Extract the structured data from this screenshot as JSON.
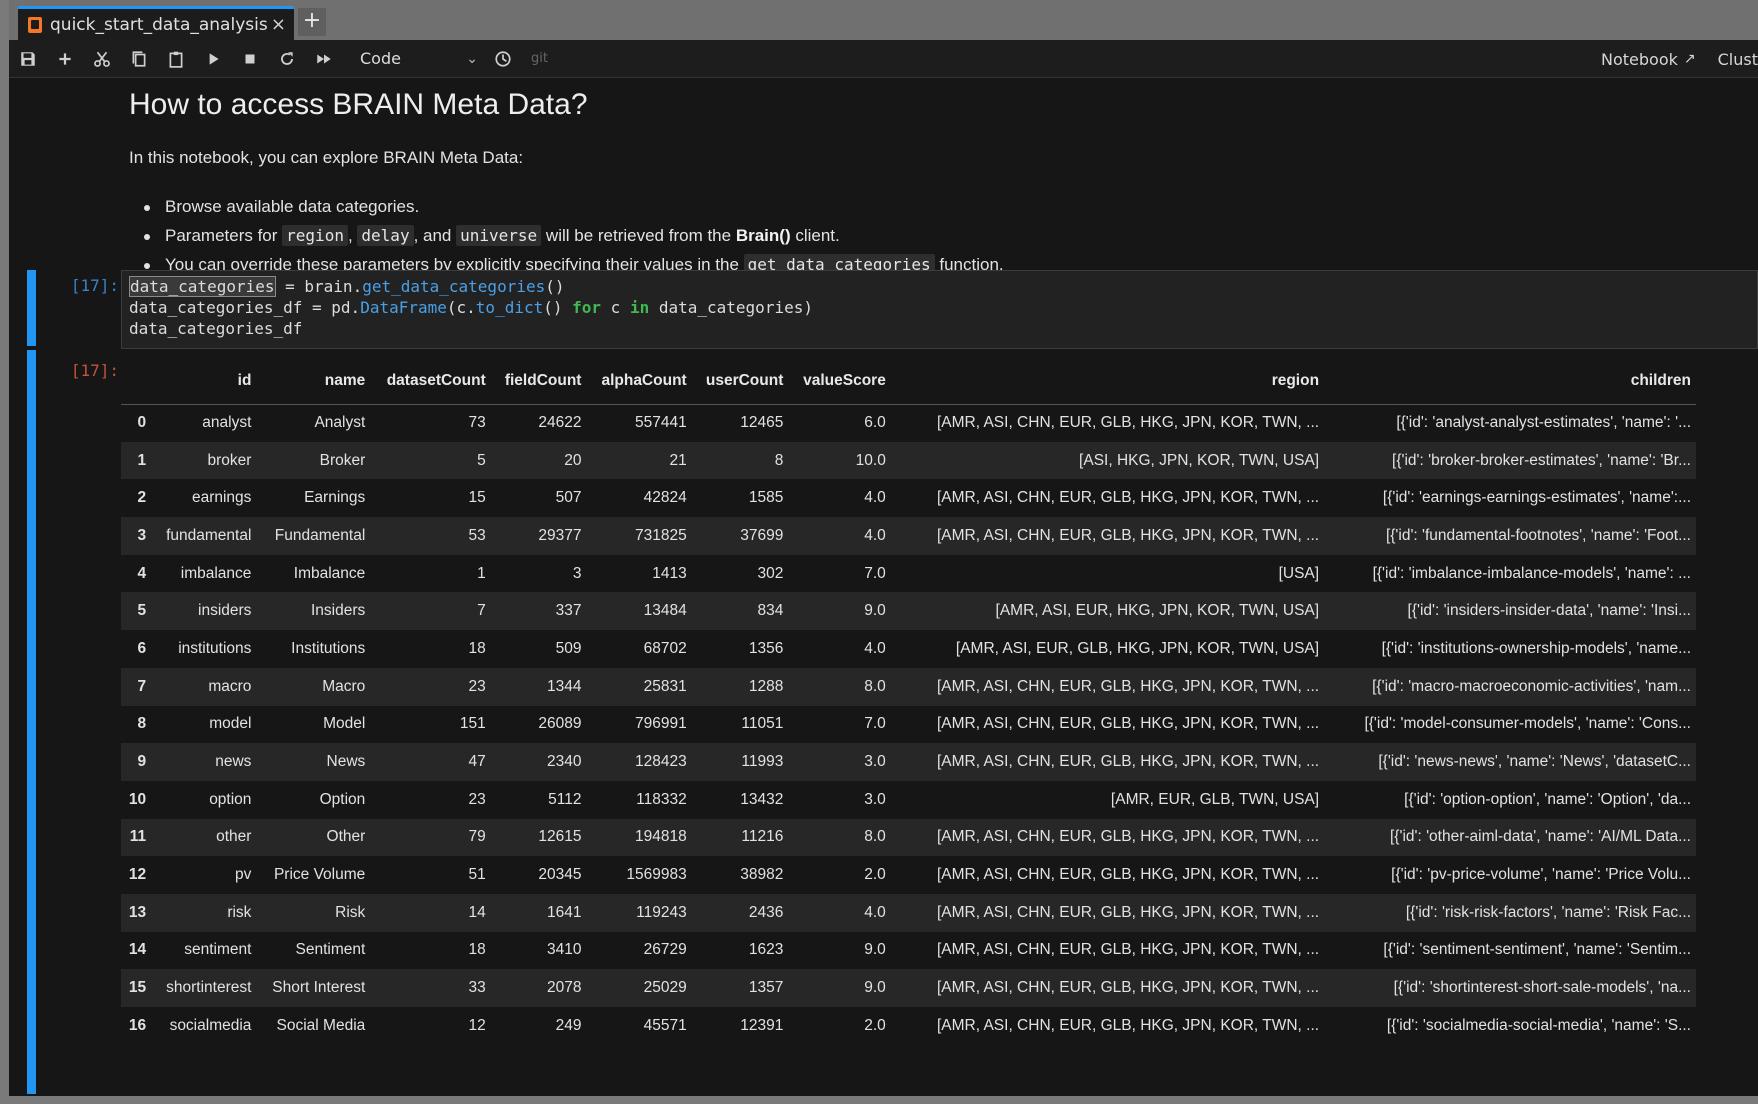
{
  "tab": {
    "title": "quick_start_data_analysis.ip",
    "close_icon": "×",
    "new_tab_icon": "+"
  },
  "toolbar": {
    "cell_type": "Code",
    "git_label": "git",
    "notebook_label": "Notebook",
    "cluster_label": "Clust"
  },
  "markdown": {
    "heading": "How to access BRAIN Meta Data?",
    "intro": "In this notebook, you can explore BRAIN Meta Data:",
    "bullet1": "Browse available data categories.",
    "bullet2": {
      "t1": "Parameters for ",
      "c1": "region",
      "t2": ", ",
      "c2": "delay",
      "t3": ", and ",
      "c3": "universe",
      "t4": " will be retrieved from the ",
      "b1": "Brain()",
      "t5": " client."
    },
    "bullet3": {
      "t1": "You can override these parameters by explicitly specifying their values in the ",
      "c1": "get_data_categories",
      "t2": " function."
    }
  },
  "code_cell": {
    "prompt": "[17]:",
    "line1": {
      "var": "data_categories",
      "op": " = brain.",
      "fn": "get_data_categories",
      "end": "()"
    },
    "line2": {
      "a": "data_categories_df = pd.",
      "fn1": "DataFrame",
      "b": "(c.",
      "fn2": "to_dict",
      "c": "() ",
      "kw1": "for",
      "d": " c ",
      "kw2": "in",
      "e": " data_categories)"
    },
    "line3": "data_categories_df"
  },
  "output": {
    "prompt": "[17]:",
    "columns": [
      "",
      "id",
      "name",
      "datasetCount",
      "fieldCount",
      "alphaCount",
      "userCount",
      "valueScore",
      "region",
      "children"
    ],
    "rows": [
      [
        "0",
        "analyst",
        "Analyst",
        "73",
        "24622",
        "557441",
        "12465",
        "6.0",
        "[AMR, ASI, CHN, EUR, GLB, HKG, JPN, KOR, TWN, ...",
        "[{'id': 'analyst-analyst-estimates', 'name': '..."
      ],
      [
        "1",
        "broker",
        "Broker",
        "5",
        "20",
        "21",
        "8",
        "10.0",
        "[ASI, HKG, JPN, KOR, TWN, USA]",
        "[{'id': 'broker-broker-estimates', 'name': 'Br..."
      ],
      [
        "2",
        "earnings",
        "Earnings",
        "15",
        "507",
        "42824",
        "1585",
        "4.0",
        "[AMR, ASI, CHN, EUR, GLB, HKG, JPN, KOR, TWN, ...",
        "[{'id': 'earnings-earnings-estimates', 'name':..."
      ],
      [
        "3",
        "fundamental",
        "Fundamental",
        "53",
        "29377",
        "731825",
        "37699",
        "4.0",
        "[AMR, ASI, CHN, EUR, GLB, HKG, JPN, KOR, TWN, ...",
        "[{'id': 'fundamental-footnotes', 'name': 'Foot..."
      ],
      [
        "4",
        "imbalance",
        "Imbalance",
        "1",
        "3",
        "1413",
        "302",
        "7.0",
        "[USA]",
        "[{'id': 'imbalance-imbalance-models', 'name': ..."
      ],
      [
        "5",
        "insiders",
        "Insiders",
        "7",
        "337",
        "13484",
        "834",
        "9.0",
        "[AMR, ASI, EUR, HKG, JPN, KOR, TWN, USA]",
        "[{'id': 'insiders-insider-data', 'name': 'Insi..."
      ],
      [
        "6",
        "institutions",
        "Institutions",
        "18",
        "509",
        "68702",
        "1356",
        "4.0",
        "[AMR, ASI, EUR, GLB, HKG, JPN, KOR, TWN, USA]",
        "[{'id': 'institutions-ownership-models', 'name..."
      ],
      [
        "7",
        "macro",
        "Macro",
        "23",
        "1344",
        "25831",
        "1288",
        "8.0",
        "[AMR, ASI, CHN, EUR, GLB, HKG, JPN, KOR, TWN, ...",
        "[{'id': 'macro-macroeconomic-activities', 'nam..."
      ],
      [
        "8",
        "model",
        "Model",
        "151",
        "26089",
        "796991",
        "11051",
        "7.0",
        "[AMR, ASI, CHN, EUR, GLB, HKG, JPN, KOR, TWN, ...",
        "[{'id': 'model-consumer-models', 'name': 'Cons..."
      ],
      [
        "9",
        "news",
        "News",
        "47",
        "2340",
        "128423",
        "11993",
        "3.0",
        "[AMR, ASI, CHN, EUR, GLB, HKG, JPN, KOR, TWN, ...",
        "[{'id': 'news-news', 'name': 'News', 'datasetC..."
      ],
      [
        "10",
        "option",
        "Option",
        "23",
        "5112",
        "118332",
        "13432",
        "3.0",
        "[AMR, EUR, GLB, TWN, USA]",
        "[{'id': 'option-option', 'name': 'Option', 'da..."
      ],
      [
        "11",
        "other",
        "Other",
        "79",
        "12615",
        "194818",
        "11216",
        "8.0",
        "[AMR, ASI, CHN, EUR, GLB, HKG, JPN, KOR, TWN, ...",
        "[{'id': 'other-aiml-data', 'name': 'AI/ML Data..."
      ],
      [
        "12",
        "pv",
        "Price Volume",
        "51",
        "20345",
        "1569983",
        "38982",
        "2.0",
        "[AMR, ASI, CHN, EUR, GLB, HKG, JPN, KOR, TWN, ...",
        "[{'id': 'pv-price-volume', 'name': 'Price Volu..."
      ],
      [
        "13",
        "risk",
        "Risk",
        "14",
        "1641",
        "119243",
        "2436",
        "4.0",
        "[AMR, ASI, CHN, EUR, GLB, HKG, JPN, KOR, TWN, ...",
        "[{'id': 'risk-risk-factors', 'name': 'Risk Fac..."
      ],
      [
        "14",
        "sentiment",
        "Sentiment",
        "18",
        "3410",
        "26729",
        "1623",
        "9.0",
        "[AMR, ASI, CHN, EUR, GLB, HKG, JPN, KOR, TWN, ...",
        "[{'id': 'sentiment-sentiment', 'name': 'Sentim..."
      ],
      [
        "15",
        "shortinterest",
        "Short Interest",
        "33",
        "2078",
        "25029",
        "1357",
        "9.0",
        "[AMR, ASI, CHN, EUR, GLB, HKG, JPN, KOR, TWN, ...",
        "[{'id': 'shortinterest-short-sale-models', 'na..."
      ],
      [
        "16",
        "socialmedia",
        "Social Media",
        "12",
        "249",
        "45571",
        "12391",
        "2.0",
        "[AMR, ASI, CHN, EUR, GLB, HKG, JPN, KOR, TWN, ...",
        "[{'id': 'socialmedia-social-media', 'name': 'S..."
      ]
    ]
  },
  "colors": {
    "accent": "#2196f3",
    "in_prompt": "#3b82c4",
    "out_prompt": "#c0553a",
    "keyword": "#3fb950",
    "function": "#4aa0e6"
  }
}
